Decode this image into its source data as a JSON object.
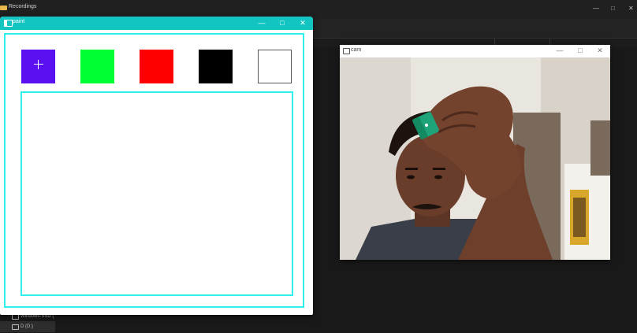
{
  "background_window": {
    "title": "Recordings",
    "sidebar_items": [
      "Windows-SSD (",
      "D (D:)"
    ]
  },
  "paint_window": {
    "title": "paint",
    "swatches": [
      {
        "name": "blue",
        "color": "#5a10f0"
      },
      {
        "name": "green",
        "color": "#00ff33"
      },
      {
        "name": "red",
        "color": "#ff0000"
      },
      {
        "name": "black",
        "color": "#000000"
      },
      {
        "name": "white",
        "color": "#ffffff"
      }
    ],
    "accent_color": "#2ff0ea",
    "titlebar_color": "#12c5c0"
  },
  "cam_window": {
    "title": "cam",
    "marker_color": "#1fa37a"
  },
  "window_controls": {
    "minimize": "—",
    "maximize": "□",
    "close": "✕"
  }
}
